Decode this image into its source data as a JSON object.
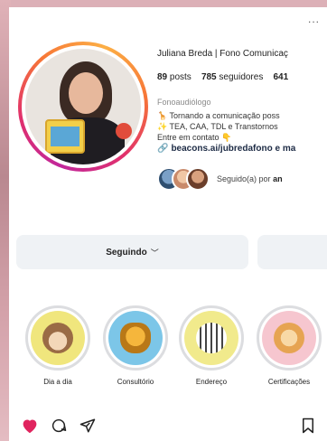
{
  "profile": {
    "name": "Juliana Breda | Fono Comunicaç",
    "stats": {
      "posts_count": "89",
      "posts_label": "posts",
      "followers_count": "785",
      "followers_label": "seguidores",
      "following_count": "641"
    },
    "category": "Fonoaudiólogo",
    "bio_lines": [
      "🦒 Tornando a comunicação poss",
      "✨ TEA, CAA, TDL e Transtornos ",
      "Entre em contato 👇"
    ],
    "link": "beacons.ai/jubredafono e ma",
    "followed_by_prefix": "Seguido(a) por",
    "followed_by_names": "an"
  },
  "actions": {
    "following_label": "Seguindo",
    "following_chevron": "﹀"
  },
  "highlights": [
    {
      "label": "Dia a dia",
      "icon": "monkey-icon"
    },
    {
      "label": "Consultório",
      "icon": "giraffe-icon"
    },
    {
      "label": "Endereço",
      "icon": "zebra-icon"
    },
    {
      "label": "Certificações",
      "icon": "lion-icon"
    }
  ],
  "more_label": "...",
  "colors": {
    "heart": "#e0245e",
    "accent_ring": "#e1306c"
  }
}
